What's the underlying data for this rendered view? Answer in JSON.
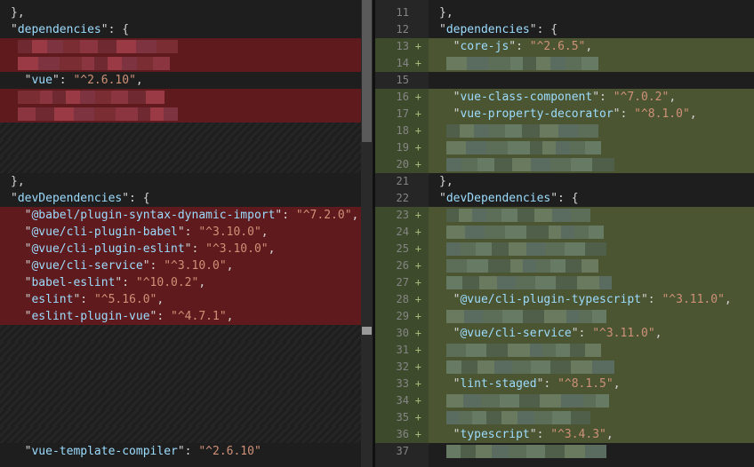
{
  "colors": {
    "deleted_bg": "#5e1a1c",
    "inserted_bg": "#4b5532",
    "key": "#9cdcfe",
    "string": "#ce9178"
  },
  "left": {
    "lines": [
      {
        "kind": "normal",
        "tokens": [
          [
            "p",
            "},"
          ]
        ]
      },
      {
        "kind": "normal",
        "tokens": [
          [
            "p",
            "\""
          ],
          [
            "k",
            "dependencies"
          ],
          [
            "p",
            "\": {"
          ]
        ]
      },
      {
        "kind": "del",
        "blur": true,
        "tokens": []
      },
      {
        "kind": "del",
        "blur": true,
        "tokens": []
      },
      {
        "kind": "normal",
        "tokens": [
          [
            "p",
            "  \""
          ],
          [
            "k",
            "vue"
          ],
          [
            "p",
            "\": "
          ],
          [
            "s",
            "\"^2.6.10\""
          ],
          [
            "p",
            ","
          ]
        ]
      },
      {
        "kind": "del",
        "blur": true,
        "tokens": []
      },
      {
        "kind": "del",
        "blur": true,
        "tokens": []
      },
      {
        "kind": "hatch",
        "tokens": []
      },
      {
        "kind": "hatch",
        "tokens": []
      },
      {
        "kind": "hatch",
        "tokens": []
      },
      {
        "kind": "normal",
        "tokens": [
          [
            "p",
            "},"
          ]
        ]
      },
      {
        "kind": "normal",
        "tokens": [
          [
            "p",
            "\""
          ],
          [
            "k",
            "devDependencies"
          ],
          [
            "p",
            "\": {"
          ]
        ]
      },
      {
        "kind": "del",
        "tokens": [
          [
            "p",
            "  \""
          ],
          [
            "k",
            "@babel/plugin-syntax-dynamic-import"
          ],
          [
            "p",
            "\": "
          ],
          [
            "s",
            "\"^7.2.0\""
          ],
          [
            "p",
            ","
          ]
        ]
      },
      {
        "kind": "del",
        "tokens": [
          [
            "p",
            "  \""
          ],
          [
            "k",
            "@vue/cli-plugin-babel"
          ],
          [
            "p",
            "\": "
          ],
          [
            "s",
            "\"^3.10.0\""
          ],
          [
            "p",
            ","
          ]
        ]
      },
      {
        "kind": "del",
        "tokens": [
          [
            "p",
            "  \""
          ],
          [
            "k",
            "@vue/cli-plugin-eslint"
          ],
          [
            "p",
            "\": "
          ],
          [
            "s",
            "\"^3.10.0\""
          ],
          [
            "p",
            ","
          ]
        ]
      },
      {
        "kind": "del",
        "tokens": [
          [
            "p",
            "  \""
          ],
          [
            "k",
            "@vue/cli-service"
          ],
          [
            "p",
            "\": "
          ],
          [
            "s",
            "\"^3.10.0\""
          ],
          [
            "p",
            ","
          ]
        ]
      },
      {
        "kind": "del",
        "tokens": [
          [
            "p",
            "  \""
          ],
          [
            "k",
            "babel-eslint"
          ],
          [
            "p",
            "\": "
          ],
          [
            "s",
            "\"^10.0.2\""
          ],
          [
            "p",
            ","
          ]
        ]
      },
      {
        "kind": "del",
        "tokens": [
          [
            "p",
            "  \""
          ],
          [
            "k",
            "eslint"
          ],
          [
            "p",
            "\": "
          ],
          [
            "s",
            "\"^5.16.0\""
          ],
          [
            "p",
            ","
          ]
        ]
      },
      {
        "kind": "del",
        "tokens": [
          [
            "p",
            "  \""
          ],
          [
            "k",
            "eslint-plugin-vue"
          ],
          [
            "p",
            "\": "
          ],
          [
            "s",
            "\"^4.7.1\""
          ],
          [
            "p",
            ","
          ]
        ]
      },
      {
        "kind": "hatch",
        "tokens": []
      },
      {
        "kind": "hatch",
        "tokens": []
      },
      {
        "kind": "hatch",
        "tokens": []
      },
      {
        "kind": "hatch",
        "tokens": []
      },
      {
        "kind": "hatch",
        "tokens": []
      },
      {
        "kind": "hatch",
        "tokens": []
      },
      {
        "kind": "hatch",
        "tokens": []
      },
      {
        "kind": "normal",
        "tokens": [
          [
            "p",
            "  \""
          ],
          [
            "k",
            "vue-template-compiler"
          ],
          [
            "p",
            "\": "
          ],
          [
            "s",
            "\"^2.6.10\""
          ]
        ]
      }
    ]
  },
  "right": {
    "lines": [
      {
        "num": "11",
        "mark": "",
        "kind": "normal",
        "tokens": [
          [
            "p",
            "},"
          ]
        ]
      },
      {
        "num": "12",
        "mark": "",
        "kind": "normal",
        "tokens": [
          [
            "p",
            "\""
          ],
          [
            "k",
            "dependencies"
          ],
          [
            "p",
            "\": {"
          ]
        ]
      },
      {
        "num": "13",
        "mark": "+",
        "kind": "ins",
        "tokens": [
          [
            "p",
            "  \""
          ],
          [
            "k",
            "core-js"
          ],
          [
            "p",
            "\": "
          ],
          [
            "s",
            "\"^2.6.5\""
          ],
          [
            "p",
            ","
          ]
        ]
      },
      {
        "num": "14",
        "mark": "+",
        "kind": "ins",
        "blur": true,
        "tokens": []
      },
      {
        "num": "15",
        "mark": "",
        "kind": "normal",
        "tokens": []
      },
      {
        "num": "16",
        "mark": "+",
        "kind": "ins",
        "tokens": [
          [
            "p",
            "  \""
          ],
          [
            "k",
            "vue-class-component"
          ],
          [
            "p",
            "\": "
          ],
          [
            "s",
            "\"^7.0.2\""
          ],
          [
            "p",
            ","
          ]
        ]
      },
      {
        "num": "17",
        "mark": "+",
        "kind": "ins",
        "tokens": [
          [
            "p",
            "  \""
          ],
          [
            "k",
            "vue-property-decorator"
          ],
          [
            "p",
            "\": "
          ],
          [
            "s",
            "\"^8.1.0\""
          ],
          [
            "p",
            ","
          ]
        ]
      },
      {
        "num": "18",
        "mark": "+",
        "kind": "ins",
        "blur": true,
        "tokens": []
      },
      {
        "num": "19",
        "mark": "+",
        "kind": "ins",
        "blur": true,
        "tokens": []
      },
      {
        "num": "20",
        "mark": "+",
        "kind": "ins",
        "blur": true,
        "tokens": []
      },
      {
        "num": "21",
        "mark": "",
        "kind": "normal",
        "tokens": [
          [
            "p",
            "},"
          ]
        ]
      },
      {
        "num": "22",
        "mark": "",
        "kind": "normal",
        "tokens": [
          [
            "p",
            "\""
          ],
          [
            "k",
            "devDependencies"
          ],
          [
            "p",
            "\": {"
          ]
        ]
      },
      {
        "num": "23",
        "mark": "+",
        "kind": "ins",
        "blur": true,
        "tokens": []
      },
      {
        "num": "24",
        "mark": "+",
        "kind": "ins",
        "blur": true,
        "tokens": []
      },
      {
        "num": "25",
        "mark": "+",
        "kind": "ins",
        "blur": true,
        "tokens": []
      },
      {
        "num": "26",
        "mark": "+",
        "kind": "ins",
        "blur": true,
        "tokens": []
      },
      {
        "num": "27",
        "mark": "+",
        "kind": "ins",
        "blur": true,
        "tokens": []
      },
      {
        "num": "28",
        "mark": "+",
        "kind": "ins",
        "tokens": [
          [
            "p",
            "  \""
          ],
          [
            "k",
            "@vue/cli-plugin-typescript"
          ],
          [
            "p",
            "\": "
          ],
          [
            "s",
            "\"^3.11.0\""
          ],
          [
            "p",
            ","
          ]
        ]
      },
      {
        "num": "29",
        "mark": "+",
        "kind": "ins",
        "blur": true,
        "tokens": []
      },
      {
        "num": "30",
        "mark": "+",
        "kind": "ins",
        "tokens": [
          [
            "p",
            "  \""
          ],
          [
            "k",
            "@vue/cli-service"
          ],
          [
            "p",
            "\": "
          ],
          [
            "s",
            "\"^3.11.0\""
          ],
          [
            "p",
            ","
          ]
        ]
      },
      {
        "num": "31",
        "mark": "+",
        "kind": "ins",
        "blur": true,
        "tokens": []
      },
      {
        "num": "32",
        "mark": "+",
        "kind": "ins",
        "blur": true,
        "tokens": []
      },
      {
        "num": "33",
        "mark": "+",
        "kind": "ins",
        "tokens": [
          [
            "p",
            "  \""
          ],
          [
            "k",
            "lint-staged"
          ],
          [
            "p",
            "\": "
          ],
          [
            "s",
            "\"^8.1.5\""
          ],
          [
            "p",
            ","
          ]
        ]
      },
      {
        "num": "34",
        "mark": "+",
        "kind": "ins",
        "blur": true,
        "tokens": []
      },
      {
        "num": "35",
        "mark": "+",
        "kind": "ins",
        "blur": true,
        "tokens": []
      },
      {
        "num": "36",
        "mark": "+",
        "kind": "ins",
        "tokens": [
          [
            "p",
            "  \""
          ],
          [
            "k",
            "typescript"
          ],
          [
            "p",
            "\": "
          ],
          [
            "s",
            "\"^3.4.3\""
          ],
          [
            "p",
            ","
          ]
        ]
      },
      {
        "num": "37",
        "mark": "",
        "kind": "normal",
        "blur": true,
        "tokens": []
      }
    ]
  }
}
